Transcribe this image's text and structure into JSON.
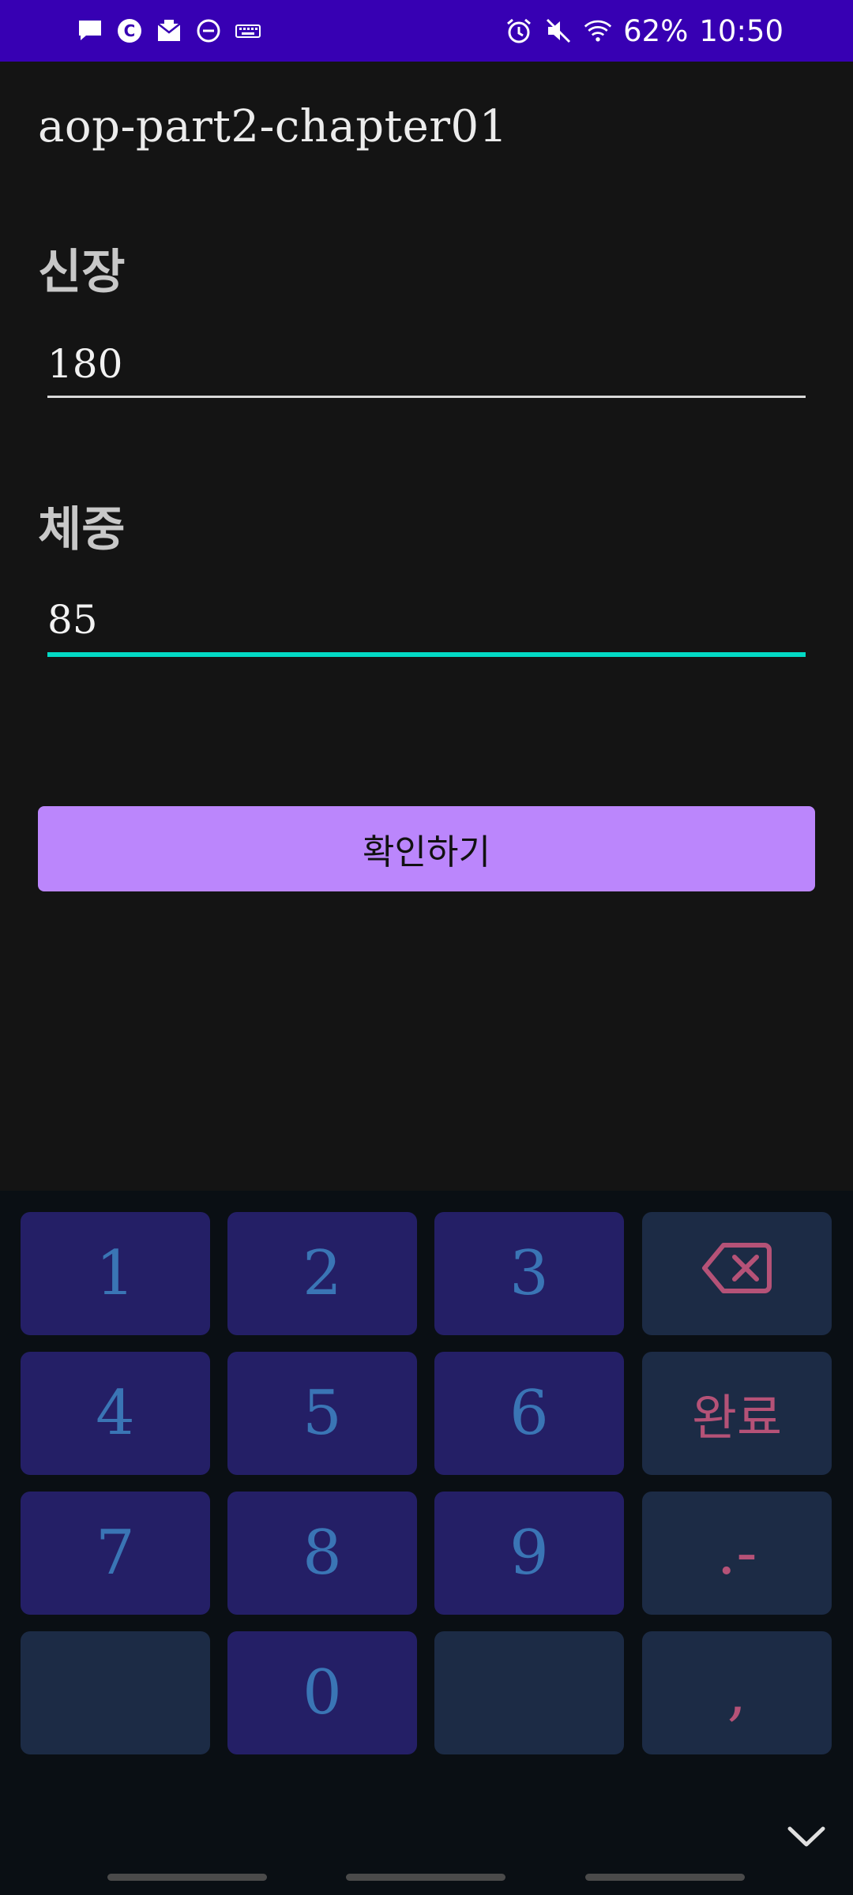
{
  "status_bar": {
    "battery": "62%",
    "time": "10:50",
    "left_icons": [
      "chat-icon",
      "c-badge-icon",
      "mail-icon",
      "dnd-icon",
      "keyboard-icon"
    ],
    "right_icons": [
      "alarm-icon",
      "mute-icon",
      "wifi-icon"
    ]
  },
  "app": {
    "title": "aop-part2-chapter01"
  },
  "form": {
    "height_label": "신장",
    "height_value": "180",
    "weight_label": "체중",
    "weight_value": "85",
    "confirm_label": "확인하기"
  },
  "keypad": {
    "k1": "1",
    "k2": "2",
    "k3": "3",
    "k4": "4",
    "k5": "5",
    "k6": "6",
    "k7": "7",
    "k8": "8",
    "k9": "9",
    "k0": "0",
    "done": "완료",
    "dot_minus": ".-",
    "comma": ","
  },
  "colors": {
    "status_bar": "#3700b3",
    "background": "#141414",
    "accent_underline": "#03dac5",
    "button": "#bb86fc",
    "key_num": "#241f66",
    "key_fn": "#1c2b45"
  }
}
